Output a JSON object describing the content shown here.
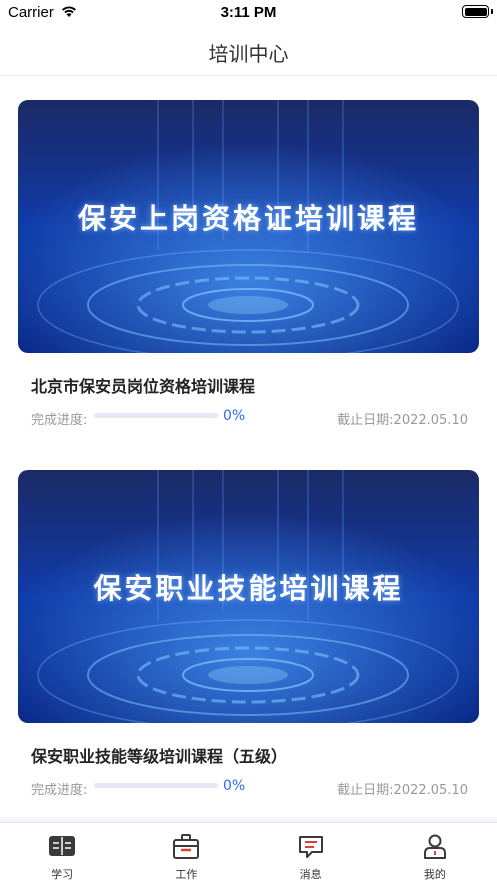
{
  "status_bar": {
    "carrier": "Carrier",
    "time": "3:11 PM"
  },
  "nav": {
    "title": "培训中心"
  },
  "colors": {
    "accent": "#2f6de1",
    "icon_red": "#e0403a",
    "icon_dark": "#3a3a3a"
  },
  "courses": [
    {
      "banner_text": "保安上岗资格证培训课程",
      "title": "北京市保安员岗位资格培训课程",
      "progress_label": "完成进度:",
      "progress_percent": 0,
      "progress_text": "0%",
      "deadline": "截止日期:2022.05.10"
    },
    {
      "banner_text": "保安职业技能培训课程",
      "title": "保安职业技能等级培训课程（五级）",
      "progress_label": "完成进度:",
      "progress_percent": 0,
      "progress_text": "0%",
      "deadline": "截止日期:2022.05.10"
    }
  ],
  "tab_bar": {
    "items": [
      {
        "label": "学习",
        "icon": "book-icon"
      },
      {
        "label": "工作",
        "icon": "briefcase-icon"
      },
      {
        "label": "消息",
        "icon": "message-icon"
      },
      {
        "label": "我的",
        "icon": "user-icon"
      }
    ]
  }
}
